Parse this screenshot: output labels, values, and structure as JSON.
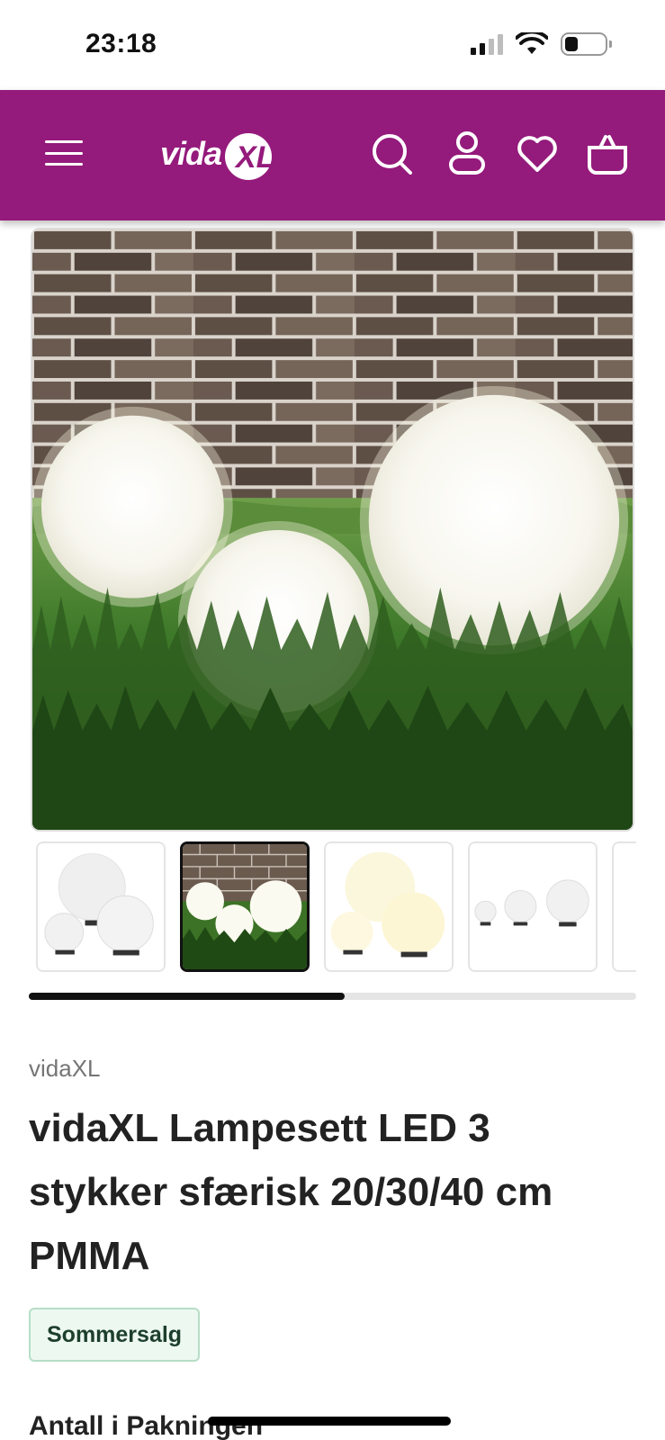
{
  "status_bar": {
    "time": "23:18"
  },
  "header": {
    "brand_color": "#941a7b",
    "logo_text": "vida",
    "logo_mark": "XL",
    "icons": [
      "menu-icon",
      "search-icon",
      "account-icon",
      "heart-icon",
      "cart-icon"
    ]
  },
  "gallery": {
    "active_index": 1,
    "thumbnail_count_visible": 5,
    "progress": 0.52
  },
  "product": {
    "brand": "vidaXL",
    "title": "vidaXL Lampesett LED 3 stykker sfærisk 20/30/40 cm PMMA",
    "badge": "Sommersalg",
    "section_label": "Antall i Pakningen"
  }
}
